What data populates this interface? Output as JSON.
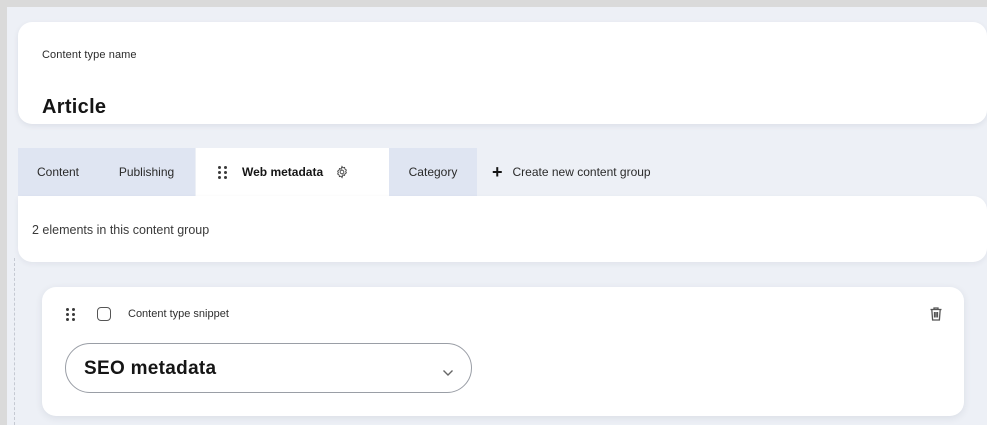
{
  "content_type": {
    "name_label": "Content type name",
    "name_value": "Article"
  },
  "tabs": [
    {
      "label": "Content",
      "active": false
    },
    {
      "label": "Publishing",
      "active": false
    },
    {
      "label": "Web metadata",
      "active": true
    },
    {
      "label": "Category",
      "active": false
    }
  ],
  "create_group": {
    "icon": "plus-icon",
    "label": "Create new content group"
  },
  "group_info": {
    "count_text": "2 elements in this content group"
  },
  "snippet_element": {
    "type_label": "Content type snippet",
    "checked": false,
    "selected_snippet": "SEO metadata",
    "icons": [
      "drag-handle-icon",
      "trash-icon",
      "chevron-down-icon"
    ]
  },
  "colors": {
    "background": "#edf0f6",
    "inactive_tab": "#dfe5f2",
    "card": "#ffffff",
    "text": "#151515"
  }
}
